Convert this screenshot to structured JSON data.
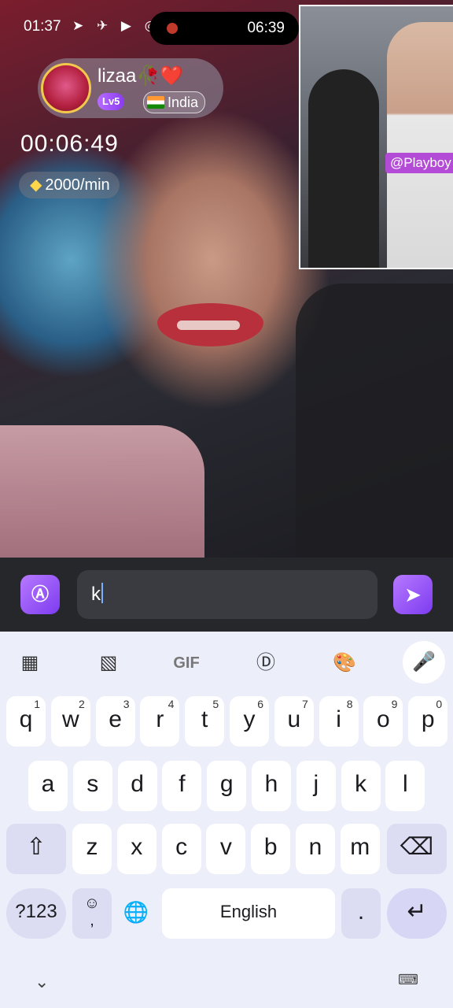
{
  "status_bar": {
    "time_left": "01:37",
    "icons": "➤ ✈ ▶ ◎",
    "time_right": "06:39"
  },
  "pip": {
    "tag": "@Playboy"
  },
  "profile": {
    "username": "lizaa🥀❤️",
    "level": "Lv5",
    "country": "India"
  },
  "call": {
    "timer": "00:06:49",
    "rate": "2000/min"
  },
  "composer": {
    "input_value": "k",
    "translate_icon": "translate-icon",
    "send_icon": "send-icon"
  },
  "keyboard": {
    "toolbar": {
      "gif_label": "GIF"
    },
    "row1": [
      {
        "k": "q",
        "h": "1"
      },
      {
        "k": "w",
        "h": "2"
      },
      {
        "k": "e",
        "h": "3"
      },
      {
        "k": "r",
        "h": "4"
      },
      {
        "k": "t",
        "h": "5"
      },
      {
        "k": "y",
        "h": "6"
      },
      {
        "k": "u",
        "h": "7"
      },
      {
        "k": "i",
        "h": "8"
      },
      {
        "k": "o",
        "h": "9"
      },
      {
        "k": "p",
        "h": "0"
      }
    ],
    "row2": [
      "a",
      "s",
      "d",
      "f",
      "g",
      "h",
      "j",
      "k",
      "l"
    ],
    "row3": [
      "z",
      "x",
      "c",
      "v",
      "b",
      "n",
      "m"
    ],
    "symbols_label": "?123",
    "comma_label": ",",
    "space_label": "English",
    "period_label": "."
  },
  "colors": {
    "accent": "#8a3cf0",
    "keyboard_bg": "#eceefa"
  }
}
